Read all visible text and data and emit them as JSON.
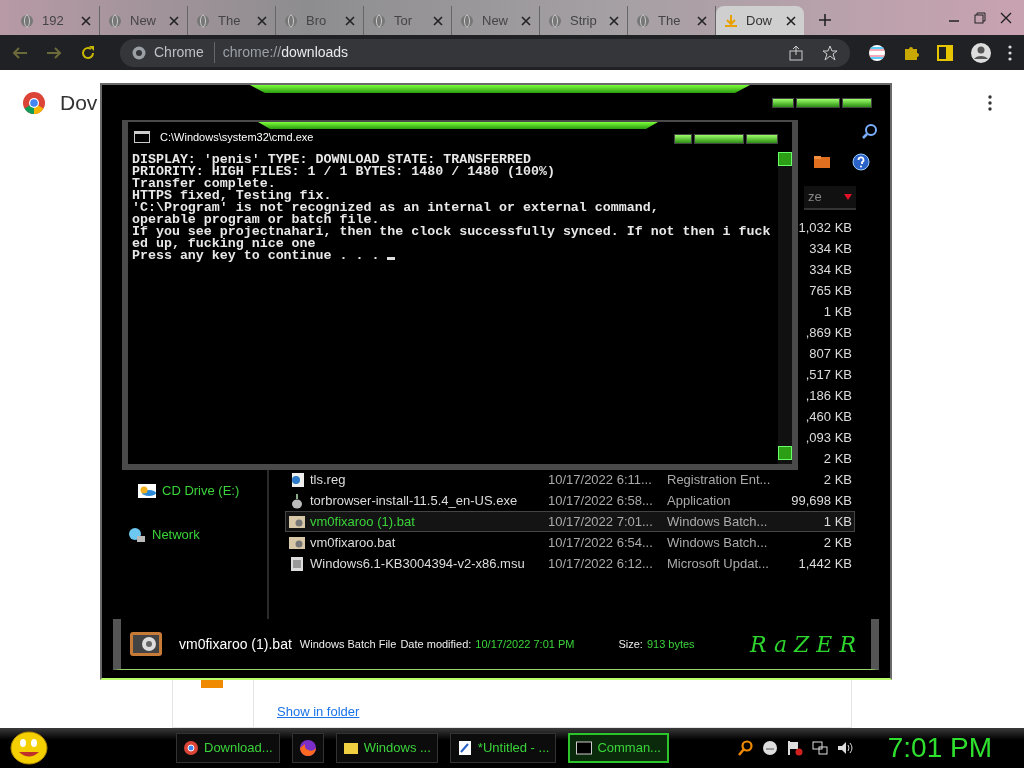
{
  "browser": {
    "tabs": [
      {
        "label": "192",
        "selected": false
      },
      {
        "label": "New",
        "selected": false
      },
      {
        "label": "The",
        "selected": false
      },
      {
        "label": "Bro",
        "selected": false
      },
      {
        "label": "Tor",
        "selected": false
      },
      {
        "label": "New",
        "selected": false
      },
      {
        "label": "Strip",
        "selected": false
      },
      {
        "label": "The",
        "selected": false
      },
      {
        "label": "Dow",
        "selected": true
      }
    ],
    "omnibox": {
      "chip": "Chrome",
      "url_scheme": "chrome://",
      "url_path": "downloads"
    }
  },
  "downloads_page": {
    "title": "Dov",
    "link": "Show in folder"
  },
  "explorer": {
    "column_header": "ze",
    "drives": [
      {
        "label": "CD Drive (E:)"
      }
    ],
    "network": "Network",
    "files": [
      {
        "size": "1,032 KB"
      },
      {
        "size": "334 KB"
      },
      {
        "size": "334 KB"
      },
      {
        "size": "765 KB"
      },
      {
        "size": "1 KB"
      },
      {
        "size": ",869 KB"
      },
      {
        "size": "807 KB"
      },
      {
        "size": ",517 KB"
      },
      {
        "size": ",186 KB"
      },
      {
        "size": ",460 KB"
      },
      {
        "size": ",093 KB"
      },
      {
        "size": "2 KB"
      },
      {
        "kind": "reg",
        "name": "tls.reg",
        "date": "10/17/2022 6:11...",
        "type": "Registration Ent...",
        "size": "2 KB",
        "selected": false
      },
      {
        "kind": "exe",
        "name": "torbrowser-install-11.5.4_en-US.exe",
        "date": "10/17/2022 6:58...",
        "type": "Application",
        "size": "99,698 KB",
        "selected": false
      },
      {
        "kind": "bat",
        "name": "vm0fixaroo (1).bat",
        "date": "10/17/2022 7:01...",
        "type": "Windows Batch...",
        "size": "1 KB",
        "selected": true
      },
      {
        "kind": "bat",
        "name": "vm0fixaroo.bat",
        "date": "10/17/2022 6:54...",
        "type": "Windows Batch...",
        "size": "2 KB",
        "selected": false
      },
      {
        "kind": "msu",
        "name": "Windows6.1-KB3004394-v2-x86.msu",
        "date": "10/17/2022 6:12...",
        "type": "Microsoft Updat...",
        "size": "1,442 KB",
        "selected": false
      }
    ],
    "details": {
      "file_name": "vm0fixaroo (1).bat",
      "file_type": "Windows Batch File",
      "date_label": "Date modified:",
      "date_value": "10/17/2022 7:01 PM",
      "size_label": "Size:",
      "size_value": "913 bytes"
    },
    "logo": "RaZER"
  },
  "console": {
    "title": "C:\\Windows\\system32\\cmd.exe",
    "lines": [
      "DISPLAY: 'penis' TYPE: DOWNLOAD STATE: TRANSFERRED",
      "PRIORITY: HIGH FILES: 1 / 1 BYTES: 1480 / 1480 (100%)",
      "Transfer complete.",
      "HTTPS fixed, Testing fix.",
      "'C:\\Program' is not recognized as an internal or external command,",
      "operable program or batch file.",
      "If you see projectnahari, then the clock successfully synced. If not then i fuck",
      "ed up, fucking nice one",
      "Press any key to continue . . . "
    ]
  },
  "taskbar": {
    "items": [
      {
        "kind": "labeled",
        "label": "Download...",
        "selected": false
      },
      {
        "kind": "icon",
        "selected": false
      },
      {
        "kind": "labeled",
        "label": "Windows ...",
        "selected": false
      },
      {
        "kind": "labeled",
        "label": "*Untitled - ...",
        "selected": false
      },
      {
        "kind": "labeled",
        "label": "Comman...",
        "selected": true
      }
    ],
    "clock": "7:01 PM"
  }
}
